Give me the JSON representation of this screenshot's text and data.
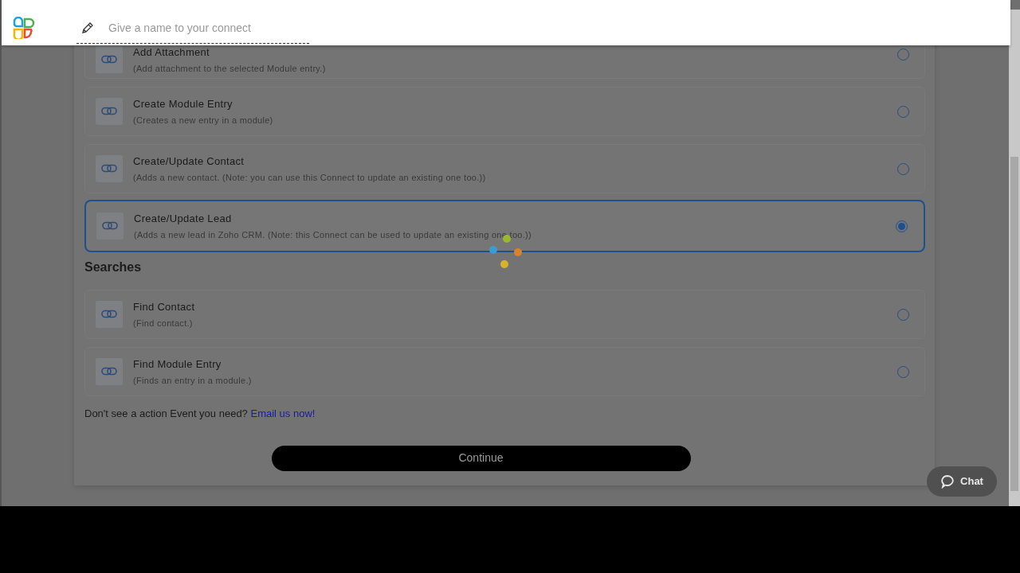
{
  "header": {
    "name_placeholder": "Give a name to your connect"
  },
  "actions": [
    {
      "title": "Add Attachment",
      "description": "(Add attachment to the selected Module entry.)",
      "selected": false
    },
    {
      "title": "Create Module Entry",
      "description": "(Creates a new entry in a module)",
      "selected": false
    },
    {
      "title": "Create/Update Contact",
      "description": "(Adds a new contact. (Note: you can use this Connect to update an existing one too.))",
      "selected": false
    },
    {
      "title": "Create/Update Lead",
      "description": "(Adds a new lead in Zoho CRM. (Note: this Connect can be used to update an existing one too.))",
      "selected": true
    }
  ],
  "searches": {
    "heading": "Searches",
    "items": [
      {
        "title": "Find Contact",
        "description": "(Find contact.)",
        "selected": false
      },
      {
        "title": "Find Module Entry",
        "description": "(Finds an entry in a module.)",
        "selected": false
      }
    ]
  },
  "footer_note": {
    "text": "Don't see a action Event you need?",
    "link": "Email us now!"
  },
  "continue_button": "Continue",
  "chat_button": "Chat"
}
